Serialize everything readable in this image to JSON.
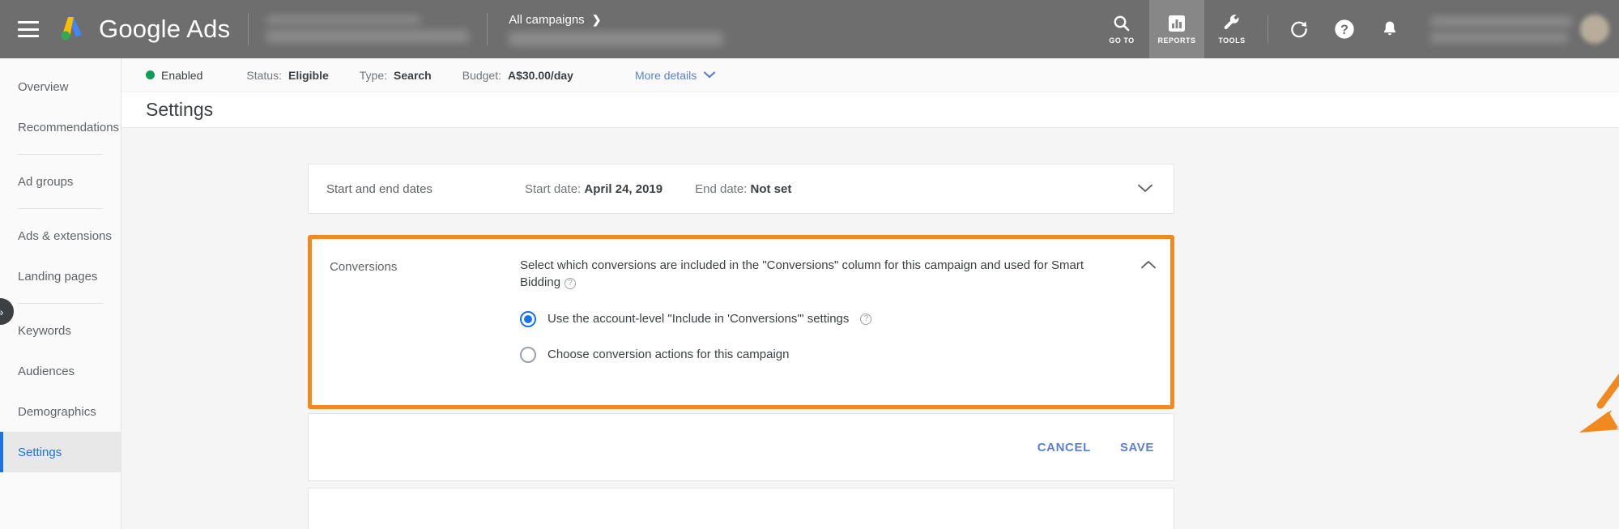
{
  "topbar": {
    "menu_icon": "hamburger-menu-icon",
    "logo_icon": "google-ads-logo",
    "brand": "Google Ads",
    "breadcrumb": "All campaigns",
    "breadcrumb_arrow": "❯",
    "tools": [
      {
        "label": "GO TO",
        "icon": "search-icon",
        "active": false
      },
      {
        "label": "REPORTS",
        "icon": "bar-chart-icon",
        "active": true
      },
      {
        "label": "TOOLS",
        "icon": "wrench-icon",
        "active": false
      }
    ],
    "refresh_icon": "refresh-icon",
    "help_icon": "help-circle-icon",
    "notifications_icon": "bell-icon",
    "avatar": "user-avatar"
  },
  "sidebar": {
    "items": [
      {
        "label": "Overview",
        "selected": false
      },
      {
        "label": "Recommendations",
        "selected": false
      },
      {
        "label": "Ad groups",
        "selected": false
      },
      {
        "label": "Ads & extensions",
        "selected": false
      },
      {
        "label": "Landing pages",
        "selected": false
      },
      {
        "label": "Keywords",
        "selected": false
      },
      {
        "label": "Audiences",
        "selected": false
      },
      {
        "label": "Demographics",
        "selected": false
      },
      {
        "label": "Settings",
        "selected": true
      }
    ],
    "expander_icon": "chevron-double-right-icon"
  },
  "status_strip": {
    "state": "Enabled",
    "status_label": "Status:",
    "status_value": "Eligible",
    "type_label": "Type:",
    "type_value": "Search",
    "budget_label": "Budget:",
    "budget_value": "A$30.00/day",
    "more_details": "More details",
    "chevron_icon": "chevron-down-icon"
  },
  "page": {
    "title": "Settings"
  },
  "dates_card": {
    "label": "Start and end dates",
    "start_label": "Start date:",
    "start_value": "April 24, 2019",
    "end_label": "End date:",
    "end_value": "Not set",
    "chevron_icon": "chevron-down-icon"
  },
  "conversions_card": {
    "label": "Conversions",
    "description": "Select which conversions are included in the \"Conversions\" column for this campaign and used for Smart Bidding",
    "help_icon": "help-circle-icon",
    "chevron_icon": "chevron-up-icon",
    "options": [
      {
        "label": "Use the account-level \"Include in 'Conversions'\" settings",
        "selected": true,
        "has_help": true
      },
      {
        "label": "Choose conversion actions for this campaign",
        "selected": false,
        "has_help": false
      }
    ]
  },
  "actions": {
    "cancel": "CANCEL",
    "save": "SAVE"
  },
  "annotation": {
    "arrow": "orange-arrow-annotation",
    "color": "#F08A20"
  },
  "colors": {
    "topbar_bg": "#6e6e6e",
    "accent_blue": "#1a73e8",
    "link_blue": "#5b7fd4",
    "highlight_orange": "#F08A20",
    "enabled_green": "#0f9d58"
  }
}
